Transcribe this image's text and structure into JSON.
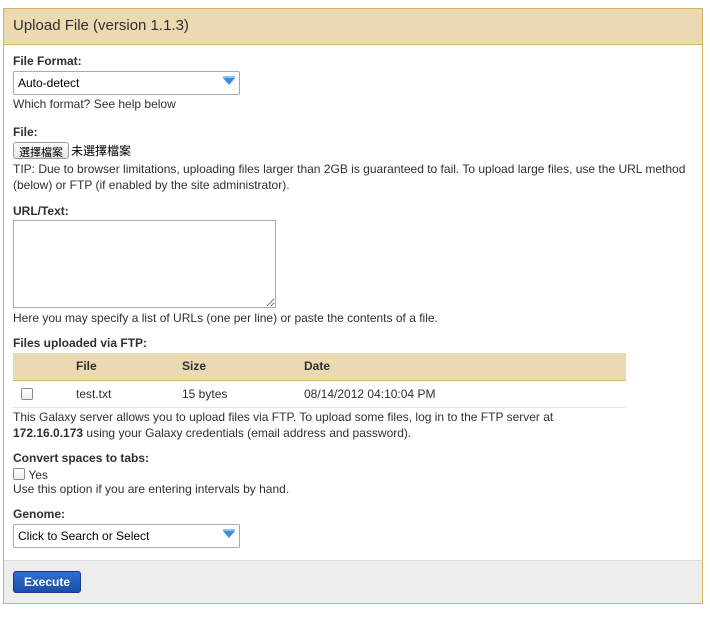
{
  "header": {
    "title": "Upload File (version 1.1.3)"
  },
  "file_format": {
    "label": "File Format:",
    "selected": "Auto-detect",
    "help": "Which format? See help below"
  },
  "file": {
    "label": "File:",
    "choose_button": "選擇檔案",
    "no_file": "未選擇檔案",
    "tip": "TIP: Due to browser limitations, uploading files larger than 2GB is guaranteed to fail. To upload large files, use the URL method (below) or FTP (if enabled by the site administrator)."
  },
  "url_text": {
    "label": "URL/Text:",
    "value": "",
    "help": "Here you may specify a list of URLs (one per line) or paste the contents of a file."
  },
  "ftp": {
    "label": "Files uploaded via FTP:",
    "columns": [
      "File",
      "Size",
      "Date"
    ],
    "rows": [
      {
        "file": "test.txt",
        "size": "15 bytes",
        "date": "08/14/2012 04:10:04 PM"
      }
    ],
    "help_prefix": "This Galaxy server allows you to upload files via FTP. To upload some files, log in to the FTP server at",
    "server": "172.16.0.173",
    "help_suffix": "using your Galaxy credentials (email address and password)."
  },
  "convert_spaces": {
    "label": "Convert spaces to tabs:",
    "option": "Yes",
    "help": "Use this option if you are entering intervals by hand."
  },
  "genome": {
    "label": "Genome:",
    "selected": "Click to Search or Select"
  },
  "footer": {
    "execute_label": "Execute"
  },
  "colors": {
    "header_bg": "#ebd9b2",
    "border": "#d8b365",
    "button_blue": "#1f57b3",
    "dropdown_arrow": "#3a8ee6"
  }
}
